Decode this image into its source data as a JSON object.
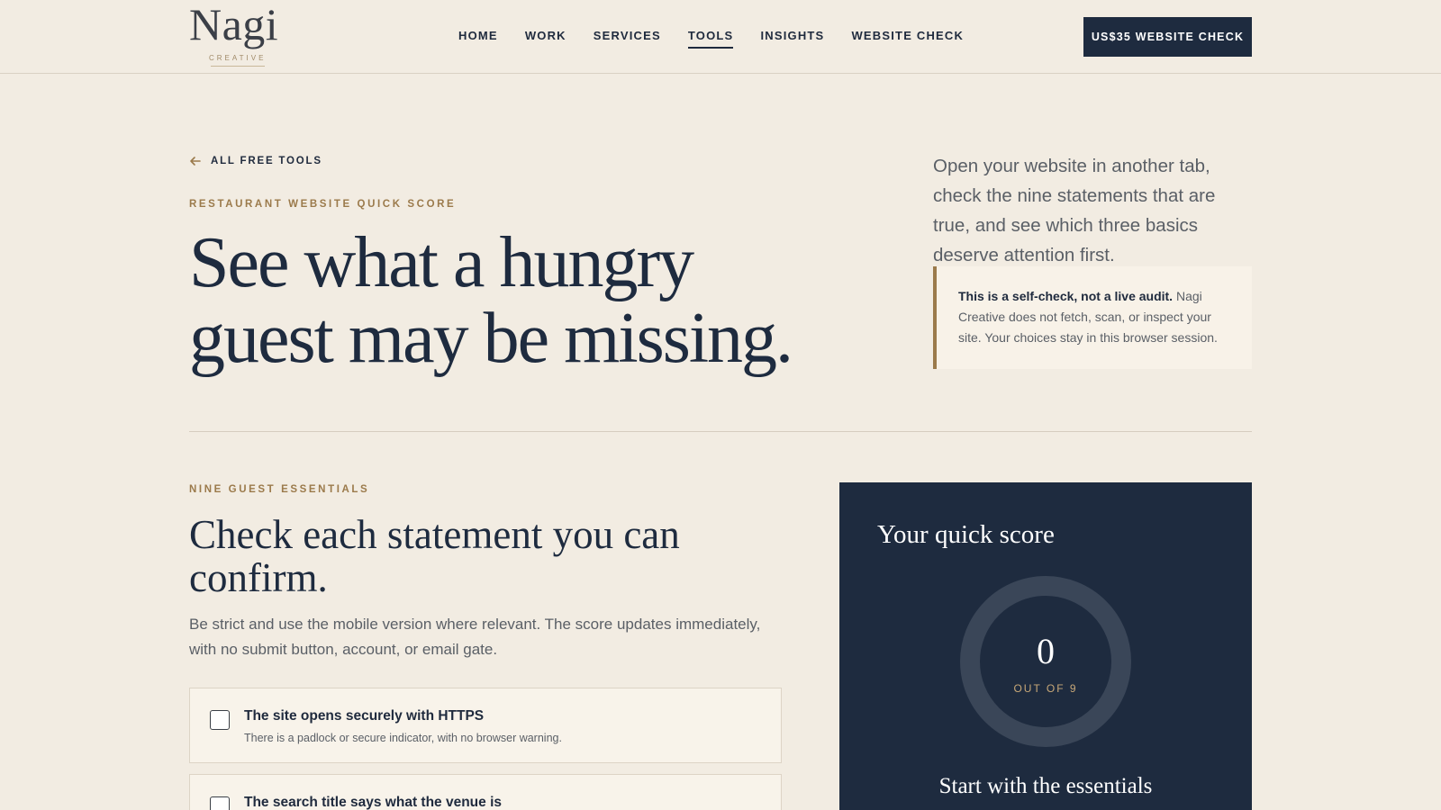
{
  "brand": {
    "name": "Nagi",
    "tagline": "CREATIVE"
  },
  "nav": {
    "items": [
      {
        "label": "HOME"
      },
      {
        "label": "WORK"
      },
      {
        "label": "SERVICES"
      },
      {
        "label": "TOOLS",
        "active": true
      },
      {
        "label": "INSIGHTS"
      },
      {
        "label": "WEBSITE CHECK"
      }
    ],
    "cta_label": "US$35 WEBSITE CHECK"
  },
  "hero": {
    "back_label": "ALL FREE TOOLS",
    "eyebrow": "RESTAURANT WEBSITE QUICK SCORE",
    "title": "See what a hungry guest may be missing.",
    "intro": "Open your website in another tab, check the nine statements that are true, and see which three basics deserve attention first.",
    "note_bold": "This is a self-check, not a live audit.",
    "note_text": " Nagi Creative does not fetch, scan, or inspect your site. Your choices stay in this browser session."
  },
  "checklist": {
    "eyebrow": "NINE GUEST ESSENTIALS",
    "title": "Check each statement you can confirm.",
    "description": "Be strict and use the mobile version where relevant. The score updates immediately, with no submit button, account, or email gate.",
    "items": [
      {
        "title": "The site opens securely with HTTPS",
        "subtitle": "There is a padlock or secure indicator, with no browser warning.",
        "checked": false
      },
      {
        "title": "The search title says what the venue is",
        "subtitle": "",
        "checked": false
      }
    ]
  },
  "score": {
    "title": "Your quick score",
    "value": "0",
    "out_of": "OUT OF 9",
    "fraction": 0,
    "subtitle": "Start with the essentials"
  },
  "colors": {
    "background": "#f2ece2",
    "navy": "#1e2b3f",
    "accent": "#9b7a4b"
  }
}
